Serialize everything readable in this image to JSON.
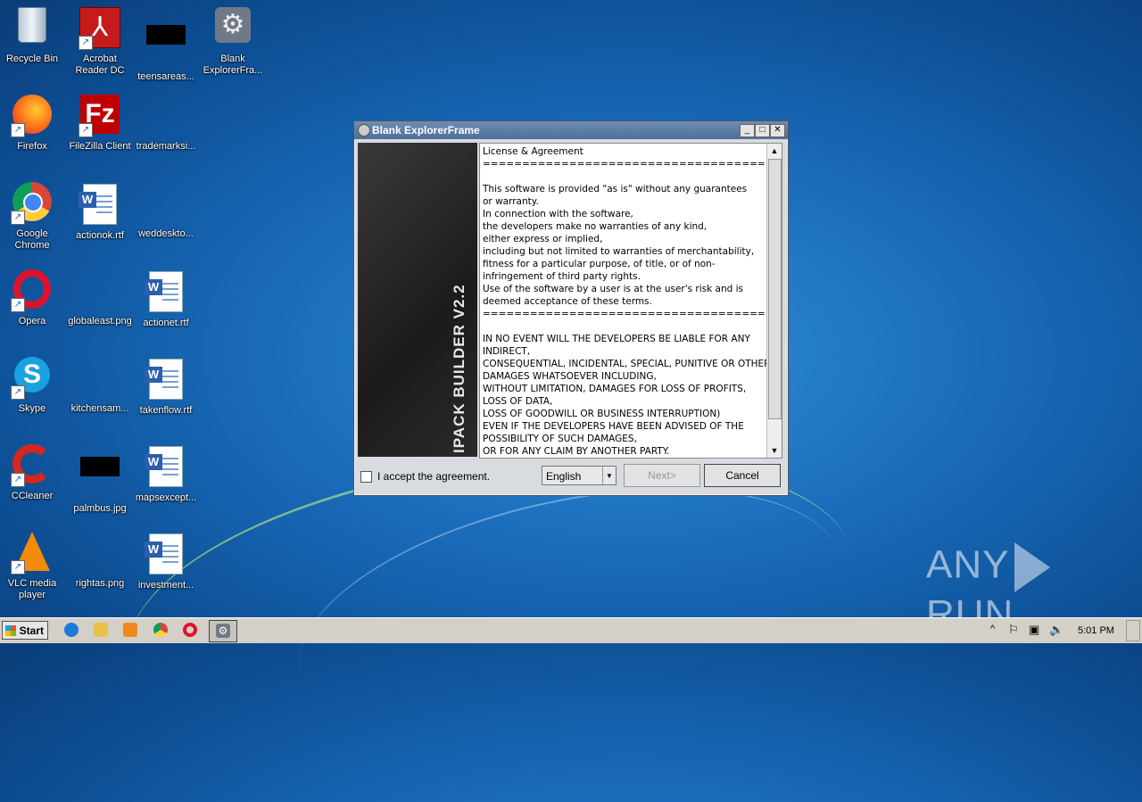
{
  "desktop": {
    "icons": [
      {
        "label": "Recycle Bin"
      },
      {
        "label": "Acrobat\nReader DC"
      },
      {
        "label": "teensareas..."
      },
      {
        "label": "Blank\nExplorerFra..."
      },
      {
        "label": "Firefox"
      },
      {
        "label": "FileZilla Client"
      },
      {
        "label": "trademarksi..."
      },
      {
        "label": "Google\nChrome"
      },
      {
        "label": "actionok.rtf"
      },
      {
        "label": "weddeskto..."
      },
      {
        "label": "Opera"
      },
      {
        "label": "globaleast.png"
      },
      {
        "label": "actionet.rtf"
      },
      {
        "label": "Skype"
      },
      {
        "label": "kitchensam..."
      },
      {
        "label": "takenflow.rtf"
      },
      {
        "label": "CCleaner"
      },
      {
        "label": "palmbus.jpg"
      },
      {
        "label": "mapsexcept..."
      },
      {
        "label": "VLC media\nplayer"
      },
      {
        "label": "rightas.png"
      },
      {
        "label": "investment..."
      }
    ]
  },
  "window": {
    "title": "Blank ExplorerFrame",
    "banner_text": "IPACK BUILDER V2.2",
    "license_text": "License & Agreement\n=====================================================\n\nThis software is provided \"as is\" without any guarantees\nor warranty.\nIn connection with the software,\nthe developers make no warranties of any kind,\neither express or implied,\nincluding but not limited to warranties of merchantability,\nfitness for a particular purpose, of title, or of non-\ninfringement of third party rights.\nUse of the software by a user is at the user's risk and is\ndeemed acceptance of these terms.\n=====================================================\n\nIN NO EVENT WILL THE DEVELOPERS BE LIABLE FOR ANY\nINDIRECT,\nCONSEQUENTIAL, INCIDENTAL, SPECIAL, PUNITIVE OR OTHER\nDAMAGES WHATSOEVER INCLUDING,\nWITHOUT LIMITATION, DAMAGES FOR LOSS OF PROFITS,\nLOSS OF DATA,\nLOSS OF GOODWILL OR BUSINESS INTERRUPTION)\nEVEN IF THE DEVELOPERS HAVE BEEN ADVISED OF THE\nPOSSIBILITY OF SUCH DAMAGES,\nOR FOR ANY CLAIM BY ANOTHER PARTY.",
    "accept_label": "I accept the agreement.",
    "accept_checked": false,
    "language": "English",
    "next_label": "Next>",
    "cancel_label": "Cancel"
  },
  "taskbar": {
    "start_label": "Start",
    "clock": "5:01 PM"
  },
  "watermark": {
    "left": "ANY",
    "right": "RUN"
  }
}
